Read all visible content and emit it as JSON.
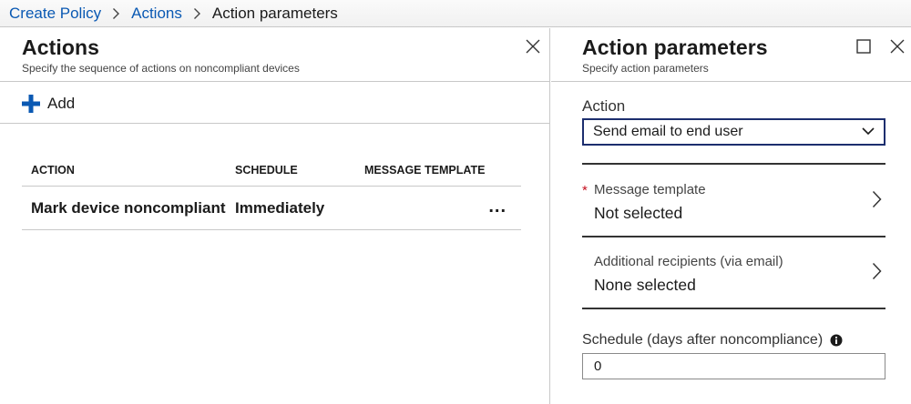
{
  "breadcrumb": {
    "items": [
      "Create Policy",
      "Actions"
    ],
    "current": "Action parameters"
  },
  "actions_panel": {
    "title": "Actions",
    "subtitle": "Specify the sequence of actions on noncompliant devices",
    "add_label": "Add",
    "columns": [
      "ACTION",
      "SCHEDULE",
      "MESSAGE TEMPLATE"
    ],
    "rows": [
      {
        "action": "Mark device noncompliant",
        "schedule": "Immediately",
        "template": "",
        "more": "..."
      }
    ]
  },
  "params_panel": {
    "title": "Action parameters",
    "subtitle": "Specify action parameters",
    "action_label": "Action",
    "action_value": "Send email to end user",
    "message_template": {
      "required_mark": "*",
      "label": "Message template",
      "value": "Not selected"
    },
    "recipients": {
      "label": "Additional recipients (via email)",
      "value": "None selected"
    },
    "schedule_label": "Schedule (days after noncompliance)",
    "schedule_value": "0"
  },
  "colors": {
    "link": "#0a59b3",
    "add_icon": "#0a59b3",
    "select_border": "#1c2e6e",
    "required": "#c50f1f"
  },
  "icons": [
    "chevron-right-icon",
    "close-icon",
    "plus-icon",
    "maximize-icon",
    "chevron-down-icon",
    "info-icon"
  ]
}
